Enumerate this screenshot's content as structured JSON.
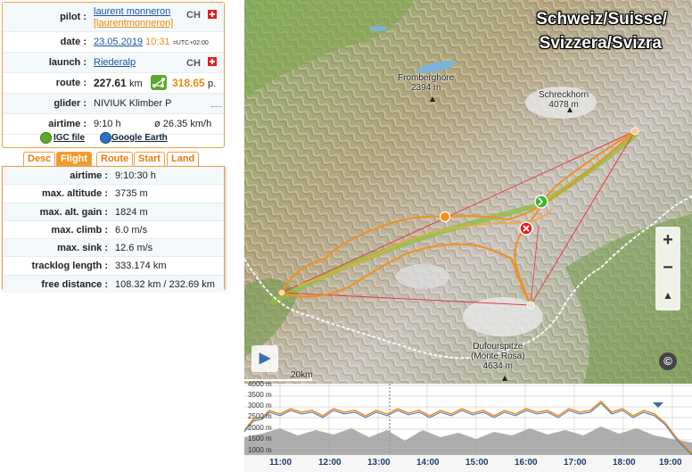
{
  "flight_info": {
    "pilot_label": "pilot :",
    "pilot_name": "laurent monneron",
    "pilot_user": "[laurentmonneron]",
    "pilot_country": "CH",
    "date_label": "date :",
    "date": "23.05.2019",
    "time": "10:31",
    "tz": "=UTC+02:00",
    "launch_label": "launch :",
    "launch": "Riederalp",
    "launch_country": "CH",
    "route_label": "route :",
    "route_distance": "227.61",
    "route_unit": "km",
    "points": "318.65",
    "points_unit": "p.",
    "glider_label": "glider :",
    "glider": "NIVIUK Klimber P",
    "airtime_label": "airtime :",
    "airtime": "9:10 h",
    "avg_speed": "ø 26.35 km/h",
    "igc_link": "IGC file",
    "ge_link": "Google Earth",
    "colors": {
      "accent": "#f29a2e",
      "link": "#1a55a0",
      "points": "#e88a10"
    }
  },
  "tabs": [
    {
      "label": "Desc",
      "active": false
    },
    {
      "label": "Flight",
      "active": true
    },
    {
      "label": "Route",
      "active": false
    },
    {
      "label": "Start",
      "active": false
    },
    {
      "label": "Land",
      "active": false
    }
  ],
  "flight_stats": [
    {
      "label": "airtime :",
      "value": "9:10:30 h"
    },
    {
      "label": "max. altitude :",
      "value": "3735 m"
    },
    {
      "label": "max. alt. gain :",
      "value": "1824 m"
    },
    {
      "label": "max. climb :",
      "value": "6.0 m/s"
    },
    {
      "label": "max. sink :",
      "value": "12.6 m/s"
    },
    {
      "label": "tracklog length :",
      "value": "333.174 km"
    },
    {
      "label": "free distance :",
      "value": "108.32 km / 232.69 km"
    }
  ],
  "map": {
    "country_line1": "Schweiz/Suisse/",
    "country_line2": "Svizzera/Svizra",
    "peaks": [
      {
        "name": "Fromberghore",
        "alt": "2394 m"
      },
      {
        "name": "Schreckhorn",
        "alt": "4078 m"
      },
      {
        "name": "Dufourspitze",
        "name2": "(Monte Rosa)",
        "alt": "4634 m"
      }
    ],
    "scale": "20km",
    "zoom_in": "+",
    "zoom_out": "−",
    "tilt": "▲",
    "copyright": "©",
    "play": "▶"
  },
  "altitude_chart": {
    "y_labels": [
      "4000 m",
      "3500 m",
      "3000 m",
      "2500 m",
      "2000 m",
      "1500 m",
      "1000 m"
    ],
    "x_labels": [
      "11:00",
      "12:00",
      "13:00",
      "14:00",
      "15:00",
      "16:00",
      "17:00",
      "18:00",
      "19:00"
    ]
  }
}
